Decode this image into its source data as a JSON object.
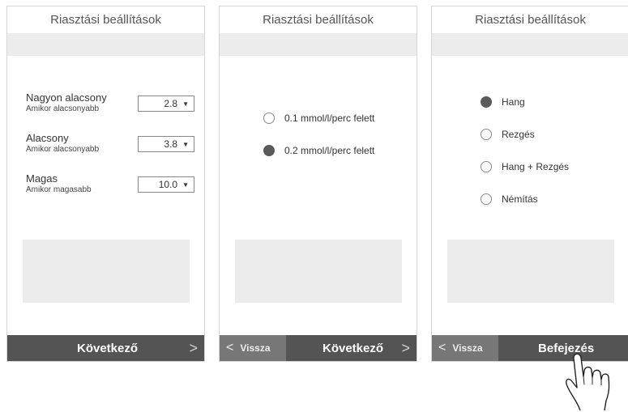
{
  "screen1": {
    "title": "Riasztási beállítások",
    "rows": [
      {
        "label": "Nagyon alacsony",
        "sub": "Amikor alacsonyabb",
        "value": "2.8"
      },
      {
        "label": "Alacsony",
        "sub": "Amikor alacsonyabb",
        "value": "3.8"
      },
      {
        "label": "Magas",
        "sub": "Amikor magasabb",
        "value": "10.0"
      }
    ],
    "next_label": "Következő",
    "next_chevron": ">"
  },
  "screen2": {
    "title": "Riasztási beállítások",
    "options": [
      {
        "label": "0.1 mmol/l/perc felett",
        "selected": false
      },
      {
        "label": "0.2 mmol/l/perc felett",
        "selected": true
      }
    ],
    "back_label": "Vissza",
    "back_chevron": "<",
    "next_label": "Következő",
    "next_chevron": ">"
  },
  "screen3": {
    "title": "Riasztási beállítások",
    "options": [
      {
        "label": "Hang",
        "selected": true
      },
      {
        "label": "Rezgés",
        "selected": false
      },
      {
        "label": "Hang + Rezgés",
        "selected": false
      },
      {
        "label": "Némítás",
        "selected": false
      }
    ],
    "back_label": "Vissza",
    "back_chevron": "<",
    "finish_label": "Befejezés"
  },
  "icons": {
    "dropdown": "triangle-down-icon",
    "hand": "pointing-hand-icon"
  },
  "colors": {
    "footer": "#545454",
    "back": "#777777",
    "band": "#ececec"
  }
}
